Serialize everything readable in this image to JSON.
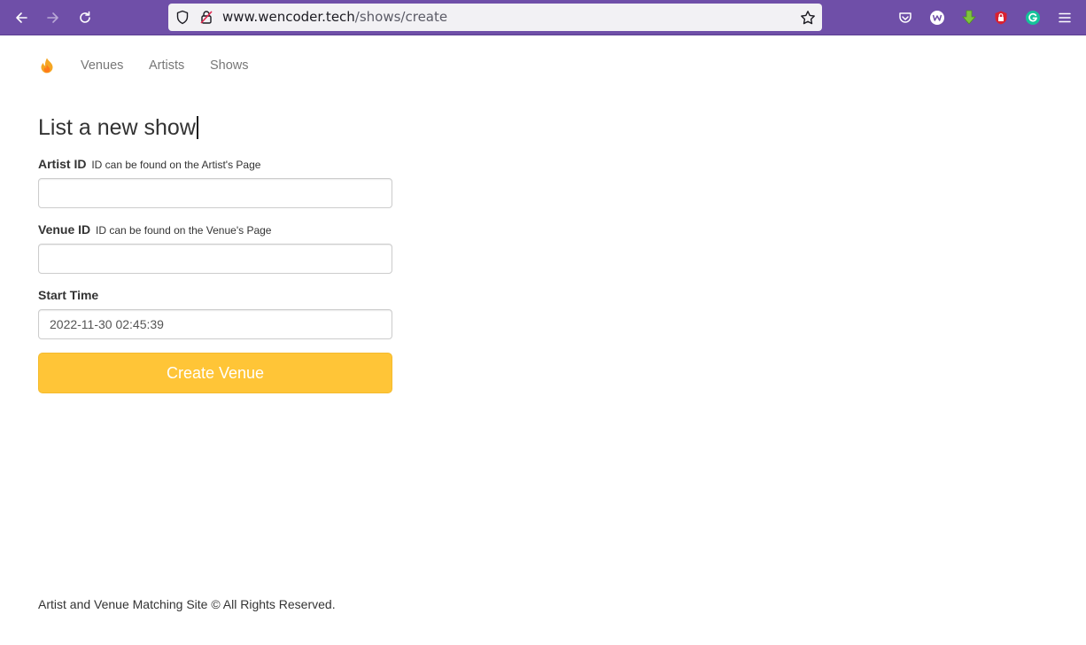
{
  "browser": {
    "url_host": "www.wencoder.tech",
    "url_path": "/shows/create",
    "toolbar_color": "#6f4fa8"
  },
  "nav": {
    "brand_icon": "flame-icon",
    "links": [
      "Venues",
      "Artists",
      "Shows"
    ]
  },
  "form": {
    "title": "List a new show",
    "artist_label": "Artist ID",
    "artist_hint": "ID can be found on the Artist's Page",
    "artist_value": "",
    "venue_label": "Venue ID",
    "venue_hint": "ID can be found on the Venue's Page",
    "venue_value": "",
    "start_label": "Start Time",
    "start_value": "2022-11-30 02:45:39",
    "submit_label": "Create Venue",
    "submit_color": "#ffc537"
  },
  "footer": {
    "text": "Artist and Venue Matching Site © All Rights Reserved."
  }
}
